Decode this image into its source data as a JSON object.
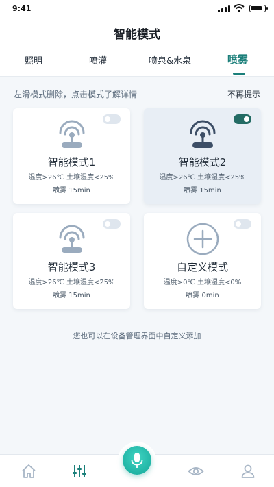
{
  "status_bar": {
    "time": "9:41"
  },
  "header": {
    "title": "智能模式"
  },
  "tabs": [
    {
      "label": "照明",
      "active": false
    },
    {
      "label": "喷灌",
      "active": false
    },
    {
      "label": "喷泉&水泉",
      "active": false
    },
    {
      "label": "喷雾",
      "active": true
    }
  ],
  "hint": {
    "text": "左滑模式删除，点击模式了解详情",
    "dismiss_label": "不再提示"
  },
  "modes": [
    {
      "name": "智能模式1",
      "conditions": "温度>26℃  土壤湿度<25%",
      "spray": "喷雾 15min",
      "enabled": false,
      "selected": false,
      "icon": "sprinkler-icon"
    },
    {
      "name": "智能模式2",
      "conditions": "温度>26℃  土壤湿度<25%",
      "spray": "喷雾 15min",
      "enabled": true,
      "selected": true,
      "icon": "sprinkler-icon"
    },
    {
      "name": "智能模式3",
      "conditions": "温度>26℃  土壤湿度<25%",
      "spray": "喷雾 15min",
      "enabled": false,
      "selected": false,
      "icon": "sprinkler-icon"
    },
    {
      "name": "自定义模式",
      "conditions": "温度>0℃  土壤湿度<0%",
      "spray": "喷雾 0min",
      "enabled": false,
      "selected": false,
      "icon": "add-circle-icon"
    }
  ],
  "footer_note": "您也可以在设备管理界面中自定义添加",
  "bottom_nav": [
    "home-icon",
    "sliders-icon",
    "microphone-icon",
    "eye-icon",
    "user-icon"
  ],
  "colors": {
    "accent": "#1b7f7a",
    "toggle_on": "#236b64",
    "icon_gray": "#9aabbe",
    "icon_dark": "#3c4e66"
  }
}
